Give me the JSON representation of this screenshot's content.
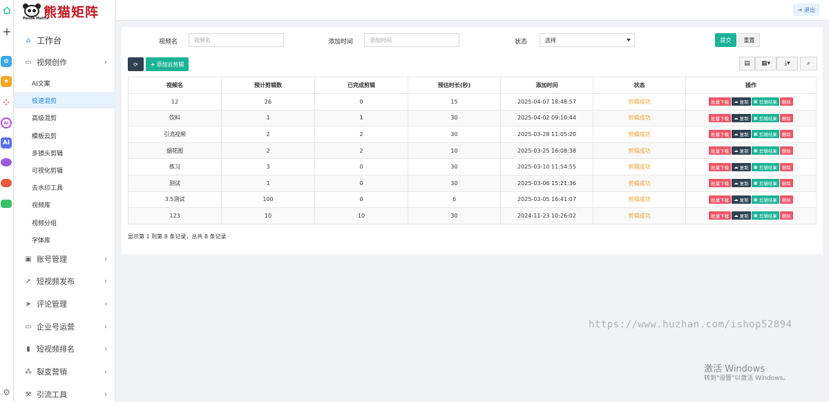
{
  "app": {
    "logo_text": "熊猫矩阵",
    "logo_sub": "Panda Matrix",
    "logout_label": "退出"
  },
  "rail": {
    "apps": [
      {
        "icon": "home-icon",
        "color": "#1ab394"
      },
      {
        "icon": "plus-icon",
        "color": "#333333"
      },
      {
        "icon": "app-blue-icon",
        "color": "#39a9e8"
      },
      {
        "icon": "app-star-icon",
        "color": "#f5a623"
      },
      {
        "icon": "app-dots-icon",
        "color": "#d0304a"
      },
      {
        "icon": "app-ai-ring-icon",
        "color": "#b44bd8"
      },
      {
        "icon": "app-ai-icon",
        "color": "#5a6fe8"
      },
      {
        "icon": "app-purple-icon",
        "color": "#9c5bd8"
      },
      {
        "icon": "app-game-icon",
        "color": "#e85a3a"
      },
      {
        "icon": "app-green-icon",
        "color": "#3bbf6a"
      },
      {
        "icon": "settings-icon",
        "color": "#777777"
      }
    ],
    "app_labels": [
      "AI"
    ]
  },
  "sidebar": {
    "items": [
      {
        "label": "工作台",
        "icon": "home-icon"
      },
      {
        "label": "视频创作",
        "icon": "video-icon"
      },
      {
        "label": "账号管理",
        "icon": "id-card-icon"
      },
      {
        "label": "短视频发布",
        "icon": "send-icon"
      },
      {
        "label": "评论管理",
        "icon": "paper-plane-icon"
      },
      {
        "label": "企业号运营",
        "icon": "monitor-icon"
      },
      {
        "label": "短视频排名",
        "icon": "bar-chart-icon"
      },
      {
        "label": "裂变营销",
        "icon": "sitemap-icon"
      },
      {
        "label": "引流工具",
        "icon": "tool-icon"
      }
    ],
    "sub_items": [
      {
        "label": "AI文案"
      },
      {
        "label": "极速混剪"
      },
      {
        "label": "高级混剪"
      },
      {
        "label": "模板云剪"
      },
      {
        "label": "多镜头剪辑"
      },
      {
        "label": "可视化剪辑"
      },
      {
        "label": "去水印工具"
      },
      {
        "label": "视频库"
      },
      {
        "label": "视频分组"
      },
      {
        "label": "字体库"
      }
    ],
    "active_sub": "极速混剪"
  },
  "filters": {
    "name_label": "视频名",
    "name_placeholder": "视频名",
    "time_label": "添加时间",
    "time_placeholder": "添加时间",
    "status_label": "状态",
    "status_value": "选择",
    "submit_label": "提交",
    "reset_label": "重置"
  },
  "toolbar": {
    "add_label": "添加云剪辑"
  },
  "table": {
    "columns": [
      "视频名",
      "预计剪辑数",
      "已完成剪辑",
      "预估时长(秒)",
      "添加时间",
      "状态",
      "操作"
    ],
    "rows": [
      [
        "12",
        "26",
        "0",
        "15",
        "2025-04-07 18:48:57",
        "剪辑成功"
      ],
      [
        "饮料",
        "1",
        "1",
        "30",
        "2025-04-02 09:10:44",
        "剪辑成功"
      ],
      [
        "引流视频",
        "2",
        "2",
        "30",
        "2025-03-28 11:05:20",
        "剪辑成功"
      ],
      [
        "烟花图",
        "2",
        "2",
        "10",
        "2025-03-25 16:08:38",
        "剪辑成功"
      ],
      [
        "练习",
        "3",
        "0",
        "30",
        "2025-03-10 11:54:55",
        "剪辑成功"
      ],
      [
        "测试",
        "1",
        "0",
        "30",
        "2025-03-06 15:21:36",
        "剪辑成功"
      ],
      [
        "3.5测试",
        "100",
        "0",
        "6",
        "2025-03-05 16:41:07",
        "剪辑成功"
      ],
      [
        "123",
        "10",
        "10",
        "30",
        "2024-11-23 10:26:02",
        "剪辑成功"
      ]
    ],
    "actions": [
      "批量下载",
      "复制",
      "剪辑结果",
      "删除"
    ],
    "footer": "显示第 1 到第 8 条记录，总共 8 条记录"
  },
  "overlay": {
    "watermark": "https://www.huzhan.com/ishop52894",
    "activate_title": "激活 Windows",
    "activate_hint": "转到\"设置\"以激活 Windows。"
  }
}
